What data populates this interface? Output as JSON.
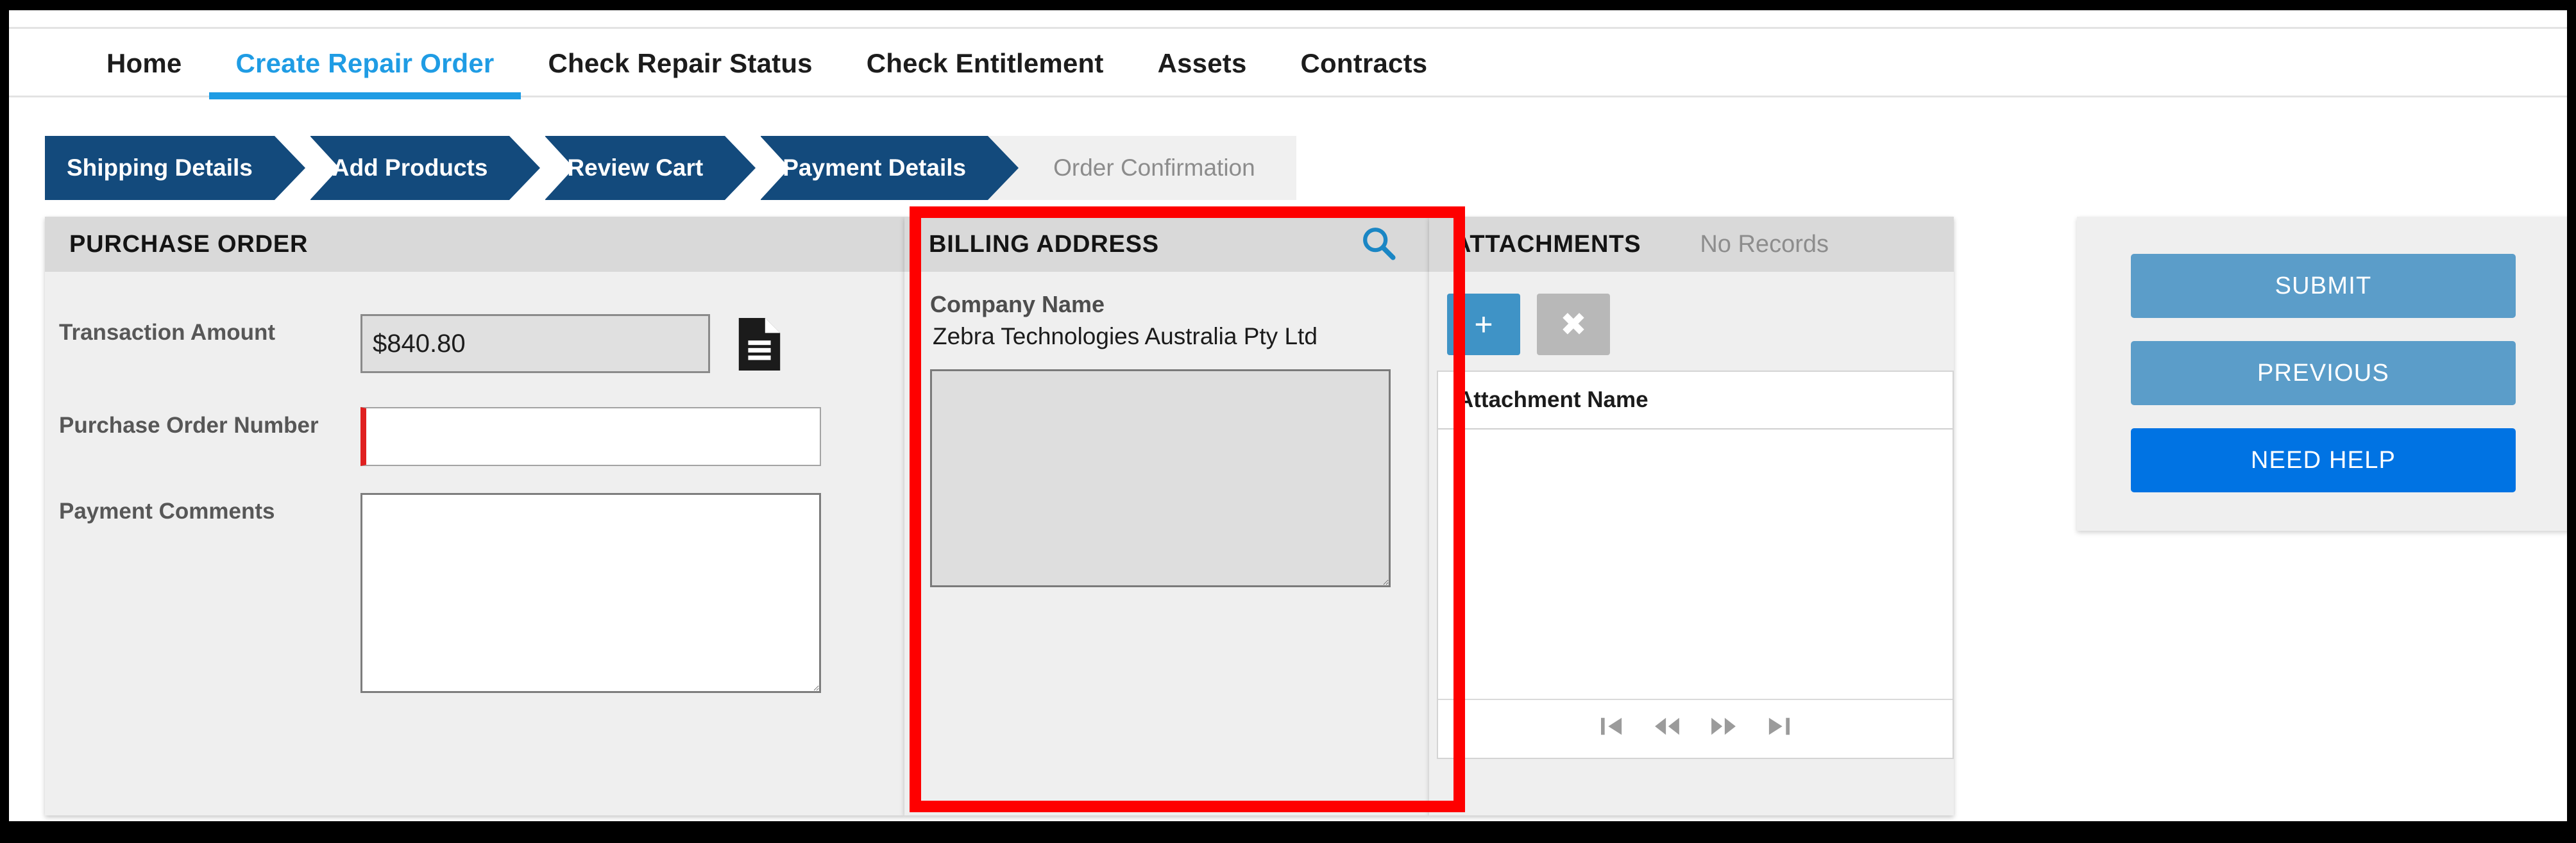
{
  "colors": {
    "accent_blue": "#1f9ce4",
    "step_blue": "#134a7c",
    "panel_header_grey": "#d9d9d9",
    "panel_body_grey": "#efefef",
    "required_red": "#e02020",
    "annotation_red": "#fe0000",
    "button_blue": "#5b9dc9",
    "help_blue": "#0073e3",
    "add_button_blue": "#3f93c6",
    "delete_button_grey": "#b8b8b8"
  },
  "nav": {
    "items": [
      {
        "label": "Home",
        "active": false
      },
      {
        "label": "Create Repair Order",
        "active": true
      },
      {
        "label": "Check Repair Status",
        "active": false
      },
      {
        "label": "Check Entitlement",
        "active": false
      },
      {
        "label": "Assets",
        "active": false
      },
      {
        "label": "Contracts",
        "active": false
      }
    ]
  },
  "stepper": {
    "steps": [
      {
        "label": "Shipping Details",
        "state": "done"
      },
      {
        "label": "Add Products",
        "state": "done"
      },
      {
        "label": "Review Cart",
        "state": "done"
      },
      {
        "label": "Payment Details",
        "state": "current"
      },
      {
        "label": "Order Confirmation",
        "state": "todo"
      }
    ]
  },
  "purchase_order": {
    "title": "PURCHASE ORDER",
    "transaction_amount_label": "Transaction Amount",
    "transaction_amount_value": "$840.80",
    "document_icon": "document-icon",
    "purchase_order_number_label": "Purchase Order Number",
    "purchase_order_number_value": "",
    "purchase_order_number_placeholder": "",
    "payment_comments_label": "Payment Comments",
    "payment_comments_value": "",
    "payment_comments_placeholder": ""
  },
  "billing_address": {
    "title": "BILLING ADDRESS",
    "search_icon": "search-icon",
    "company_name_label": "Company Name",
    "company_name_value": "Zebra Technologies Australia Pty Ltd",
    "address_value": "",
    "address_placeholder": ""
  },
  "attachments": {
    "title": "ATTACHMENTS",
    "status": "No Records",
    "add_label": "+",
    "delete_label": "✖",
    "columns": [
      "Attachment Name"
    ],
    "rows": [],
    "pager": {
      "first": "⏮",
      "previous": "⏪",
      "next": "⏩",
      "last": "⏭"
    }
  },
  "actions": {
    "submit_label": "SUBMIT",
    "previous_label": "PREVIOUS",
    "need_help_label": "NEED HELP"
  }
}
